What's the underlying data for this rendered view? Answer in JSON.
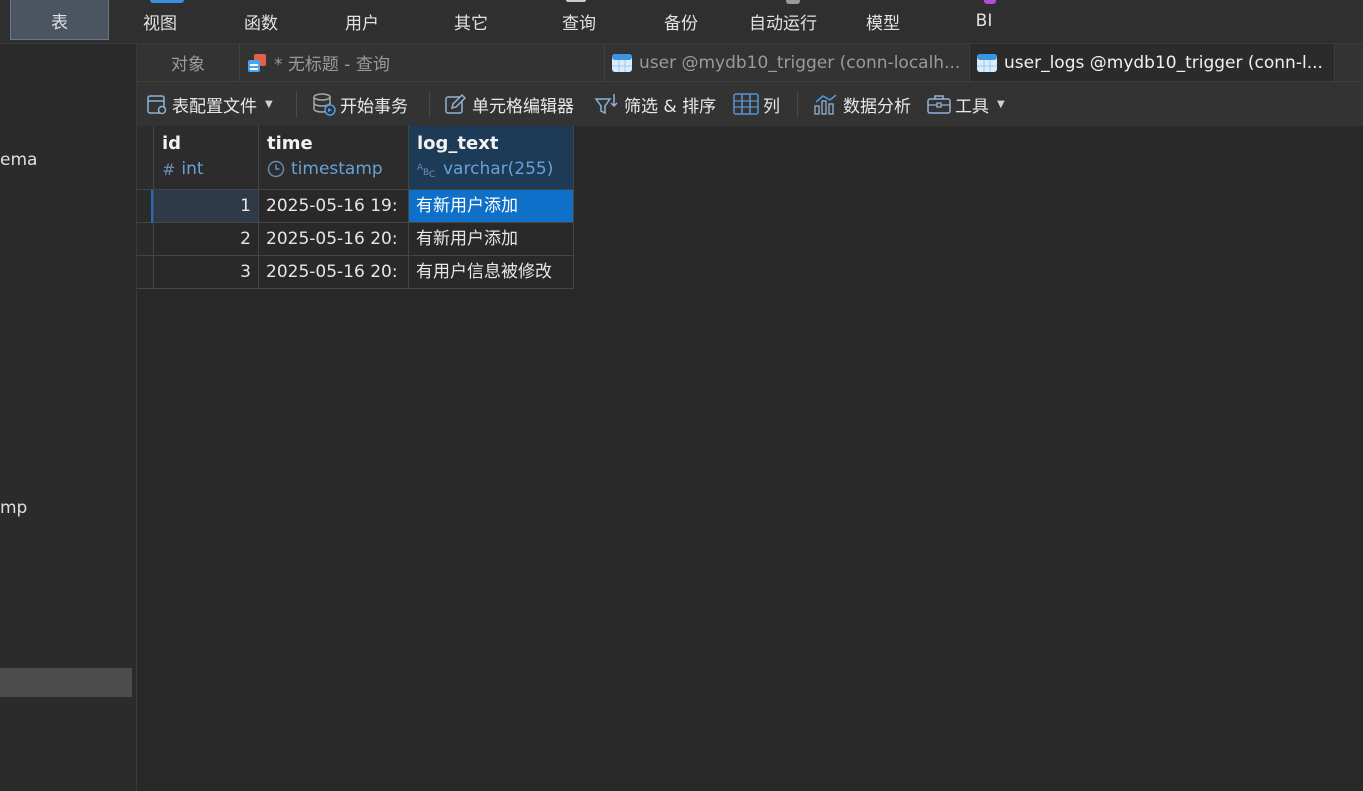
{
  "ribbon": {
    "items": [
      "表",
      "视图",
      "函数",
      "用户",
      "其它",
      "查询",
      "备份",
      "自动运行",
      "模型",
      "BI"
    ],
    "active": "表"
  },
  "sidebar": {
    "fragment_schema": "ema",
    "fragment_timestamp": "mp"
  },
  "tabs": {
    "objects": "对象",
    "query": "* 无标题 - 查询",
    "user_table": "user @mydb10_trigger (conn-localh...",
    "user_logs_table": "user_logs @mydb10_trigger (conn-l..."
  },
  "toolbar": {
    "table_profile": "表配置文件",
    "begin_transaction": "开始事务",
    "cell_editor": "单元格编辑器",
    "filter_sort": "筛选 & 排序",
    "columns": "列",
    "data_analysis": "数据分析",
    "tools": "工具"
  },
  "grid": {
    "columns": [
      {
        "name": "id",
        "type": "int",
        "icon": "hash-icon"
      },
      {
        "name": "time",
        "type": "timestamp",
        "icon": "clock-icon"
      },
      {
        "name": "log_text",
        "type": "varchar(255)",
        "icon": "text-type-icon"
      }
    ],
    "rows": [
      {
        "id": "1",
        "time": "2025-05-16 19:",
        "log_text": "有新用户添加"
      },
      {
        "id": "2",
        "time": "2025-05-16 20:",
        "log_text": "有新用户添加"
      },
      {
        "id": "3",
        "time": "2025-05-16 20:",
        "log_text": "有用户信息被修改"
      }
    ],
    "selected_cell": {
      "row": 1,
      "column": "log_text"
    }
  },
  "colors": {
    "background": "#282828",
    "accent_selection": "#0e70c8",
    "header_selected": "#1d3a57",
    "type_text": "#6aa0d8"
  }
}
